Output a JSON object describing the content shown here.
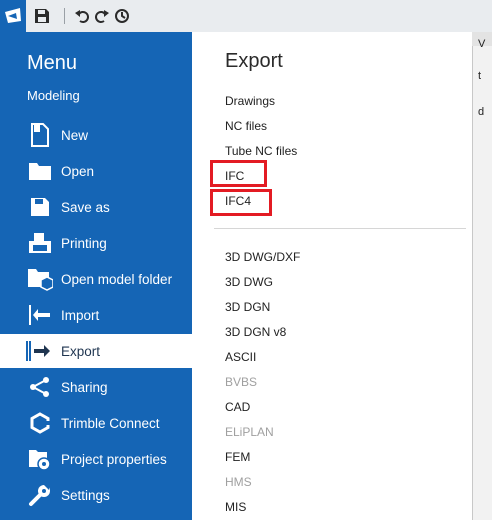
{
  "toolbar": {
    "icons": [
      "app-logo-icon",
      "save-icon",
      "undo-icon",
      "redo-icon",
      "history-icon"
    ]
  },
  "menu": {
    "title": "Menu",
    "subtitle": "Modeling",
    "items": [
      {
        "label": "New",
        "icon": "new-file-icon"
      },
      {
        "label": "Open",
        "icon": "folder-icon"
      },
      {
        "label": "Save as",
        "icon": "save-icon"
      },
      {
        "label": "Printing",
        "icon": "printer-icon"
      },
      {
        "label": "Open model folder",
        "icon": "model-folder-icon"
      },
      {
        "label": "Import",
        "icon": "import-icon"
      },
      {
        "label": "Export",
        "icon": "export-icon"
      },
      {
        "label": "Sharing",
        "icon": "share-icon"
      },
      {
        "label": "Trimble Connect",
        "icon": "trimble-connect-icon"
      },
      {
        "label": "Project properties",
        "icon": "project-properties-icon"
      },
      {
        "label": "Settings",
        "icon": "settings-icon"
      }
    ],
    "active": "Export"
  },
  "export": {
    "title": "Export",
    "items": [
      {
        "label": "Drawings",
        "enabled": true
      },
      {
        "label": "NC files",
        "enabled": true
      },
      {
        "label": "Tube NC files",
        "enabled": true
      },
      {
        "label": "IFC",
        "enabled": true,
        "highlighted": true
      },
      {
        "label": "IFC4",
        "enabled": true,
        "highlighted": true
      },
      {
        "label": "3D DWG/DXF",
        "enabled": true
      },
      {
        "label": "3D DWG",
        "enabled": true
      },
      {
        "label": "3D DGN",
        "enabled": true
      },
      {
        "label": "3D DGN v8",
        "enabled": true
      },
      {
        "label": "ASCII",
        "enabled": true
      },
      {
        "label": "BVBS",
        "enabled": false
      },
      {
        "label": "CAD",
        "enabled": true
      },
      {
        "label": "ELiPLAN",
        "enabled": false
      },
      {
        "label": "FEM",
        "enabled": true
      },
      {
        "label": "HMS",
        "enabled": false
      },
      {
        "label": "MIS",
        "enabled": true
      }
    ]
  },
  "background_window": {
    "fragments": [
      "V",
      "t",
      "d"
    ]
  },
  "colors": {
    "menu_bg": "#1565b5",
    "highlight_box": "#e31b23",
    "disabled_text": "#a0a0a0"
  }
}
